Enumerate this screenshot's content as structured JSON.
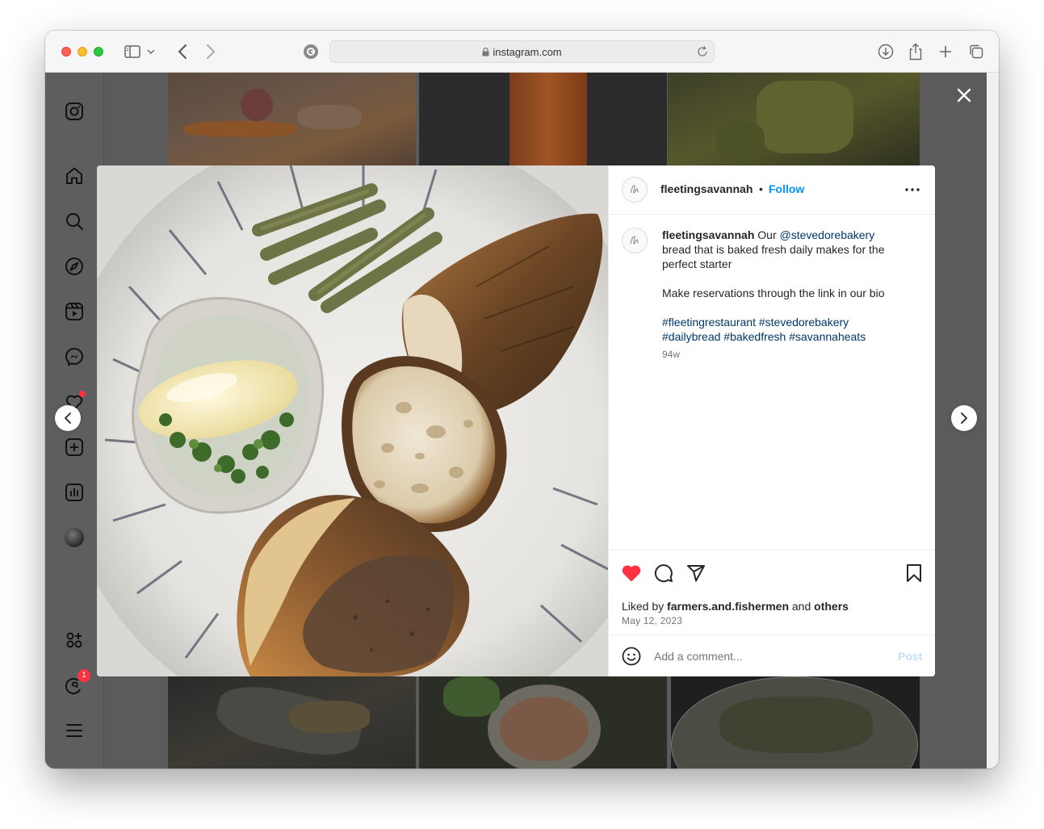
{
  "browser": {
    "url": "instagram.com"
  },
  "post": {
    "username": "fleetingsavannah",
    "separator": "•",
    "follow_label": "Follow",
    "caption_username": "fleetingsavannah",
    "caption_line1_text": " Our ",
    "caption_mention": "@stevedorebakery",
    "caption_line1_rest": " bread that is baked fresh daily makes for the perfect starter",
    "caption_line2": "Make reservations through the link in our bio",
    "hashtags": [
      "#fleetingrestaurant",
      "#stevedorebakery",
      "#dailybread",
      "#bakedfresh",
      "#savannaheats"
    ],
    "caption_age": "94w",
    "liked_by_prefix": "Liked by ",
    "liked_by_user": "farmers.and.fishermen",
    "liked_by_and": " and ",
    "liked_by_others": "others",
    "date": "May 12, 2023",
    "comment_placeholder": "Add a comment...",
    "post_button": "Post",
    "liked": true
  },
  "sidebar": {
    "items": [
      "instagram-logo",
      "home",
      "search",
      "explore",
      "reels",
      "messenger",
      "notifications",
      "create",
      "dashboard",
      "profile",
      "threads-apps",
      "threads",
      "more"
    ],
    "threads_badge": "1"
  },
  "colors": {
    "accent_blue": "#0095f6",
    "like_red": "#ff3040",
    "hashtag_blue": "#00376b"
  }
}
